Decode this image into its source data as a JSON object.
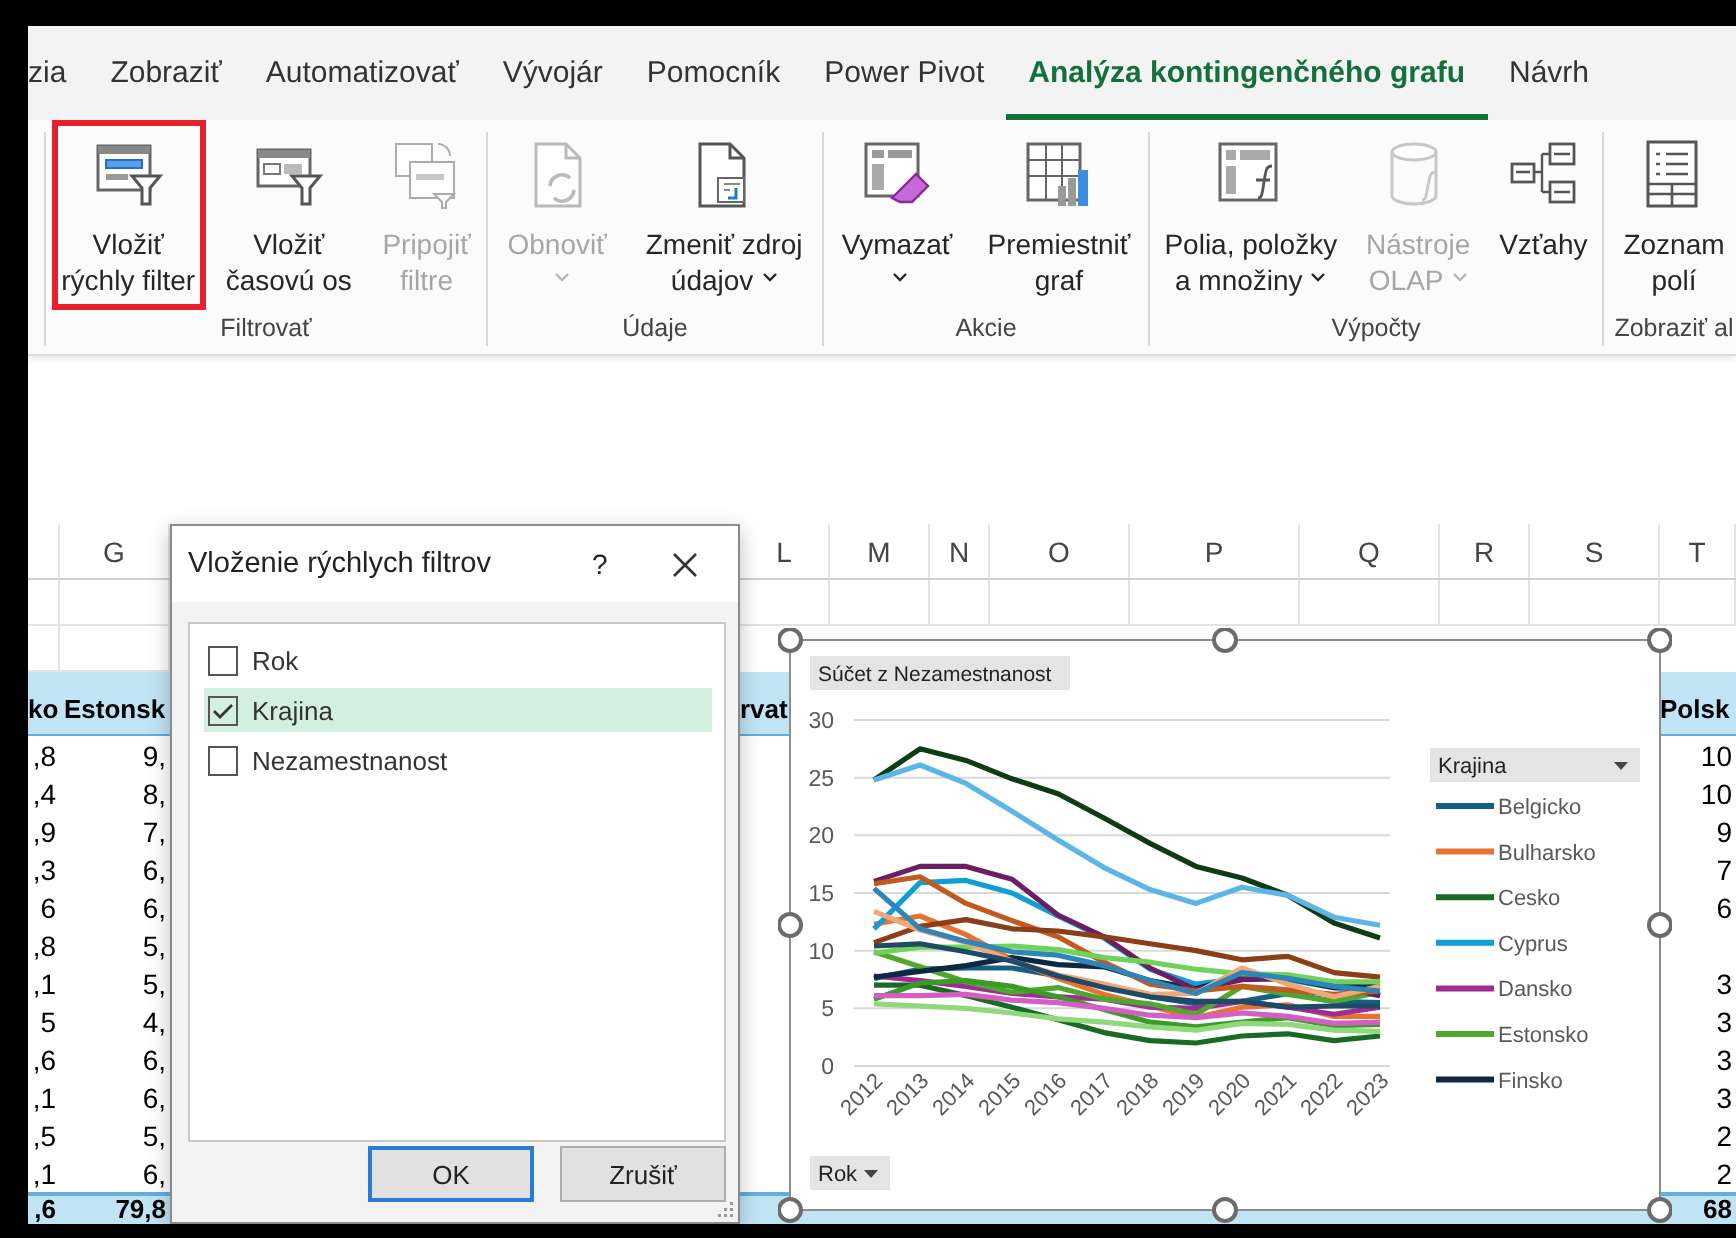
{
  "ribbon": {
    "tabs": [
      {
        "label": "zia",
        "selected": false
      },
      {
        "label": "Zobraziť",
        "selected": false
      },
      {
        "label": "Automatizovať",
        "selected": false
      },
      {
        "label": "Vývojár",
        "selected": false
      },
      {
        "label": "Pomocník",
        "selected": false
      },
      {
        "label": "Power Pivot",
        "selected": false
      },
      {
        "label": "Analýza kontingenčného grafu",
        "selected": true
      },
      {
        "label": "Návrh",
        "selected": false
      }
    ],
    "groups": [
      {
        "label": "Filtrovať",
        "buttons": [
          {
            "lines": [
              "Vložiť",
              "rýchly filter"
            ],
            "dropdown": false,
            "disabled": false,
            "highlighted": true
          },
          {
            "lines": [
              "Vložiť",
              "časovú os"
            ],
            "dropdown": false,
            "disabled": false,
            "highlighted": false
          },
          {
            "lines": [
              "Pripojiť",
              "filtre"
            ],
            "dropdown": false,
            "disabled": true,
            "highlighted": false
          }
        ]
      },
      {
        "label": "Údaje",
        "buttons": [
          {
            "lines": [
              "Obnoviť"
            ],
            "dropdown": true,
            "disabled": true,
            "highlighted": false
          },
          {
            "lines": [
              "Zmeniť zdroj",
              "údajov"
            ],
            "dropdown": true,
            "disabled": false,
            "highlighted": false
          }
        ]
      },
      {
        "label": "Akcie",
        "buttons": [
          {
            "lines": [
              "Vymazať"
            ],
            "dropdown": true,
            "disabled": false,
            "highlighted": false
          },
          {
            "lines": [
              "Premiestniť",
              "graf"
            ],
            "dropdown": false,
            "disabled": false,
            "highlighted": false
          }
        ]
      },
      {
        "label": "Výpočty",
        "buttons": [
          {
            "lines": [
              "Polia, položky",
              "a množiny"
            ],
            "dropdown": true,
            "disabled": false,
            "highlighted": false
          },
          {
            "lines": [
              "Nástroje",
              "OLAP"
            ],
            "dropdown": true,
            "disabled": true,
            "highlighted": false
          },
          {
            "lines": [
              "Vzťahy"
            ],
            "dropdown": false,
            "disabled": false,
            "highlighted": false
          }
        ]
      },
      {
        "label": "Zobraziť al",
        "buttons": [
          {
            "lines": [
              "Zoznam",
              "polí"
            ],
            "dropdown": false,
            "disabled": false,
            "highlighted": false
          }
        ]
      }
    ]
  },
  "sheet": {
    "column_headers": [
      "G",
      "L",
      "M",
      "N",
      "O",
      "P",
      "Q",
      "R",
      "S",
      "T"
    ],
    "table": {
      "header": {
        "column_1": "ko",
        "column_2": "Estonsk",
        "column_3": "rvat",
        "column_4": "Polsk"
      },
      "rows": [
        {
          "column_1": ",8",
          "column_2": "9,",
          "column_4": "10"
        },
        {
          "column_1": ",4",
          "column_2": "8,",
          "column_4": "10"
        },
        {
          "column_1": ",9",
          "column_2": "7,",
          "column_4": "9"
        },
        {
          "column_1": ",3",
          "column_2": "6,",
          "column_4": "7"
        },
        {
          "column_1": "6",
          "column_2": "6,",
          "column_4": "6"
        },
        {
          "column_1": ",8",
          "column_2": "5,"
        },
        {
          "column_1": ",1",
          "column_2": "5,",
          "column_4": "3"
        },
        {
          "column_1": "5",
          "column_2": "4,",
          "column_4": "3"
        },
        {
          "column_1": ",6",
          "column_2": "6,",
          "column_4": "3"
        },
        {
          "column_1": ",1",
          "column_2": "6,",
          "column_4": "3"
        },
        {
          "column_1": ",5",
          "column_2": "5,",
          "column_4": "2"
        },
        {
          "column_1": ",1",
          "column_2": "6,",
          "column_4": "2"
        }
      ],
      "total": {
        "column_1": ",6",
        "column_2": "79,8",
        "column_4": "68"
      }
    }
  },
  "dialog": {
    "title": "Vloženie rýchlych filtrov",
    "help": "?",
    "items": [
      {
        "label": "Rok",
        "checked": false,
        "selected": false
      },
      {
        "label": "Krajina",
        "checked": true,
        "selected": true
      },
      {
        "label": "Nezamestnanost",
        "checked": false,
        "selected": false
      }
    ],
    "buttons": [
      {
        "label": "OK",
        "default": true
      },
      {
        "label": "Zrušiť",
        "default": false
      }
    ]
  },
  "chart": {
    "value_button": "Súčet z Nezamestnanost",
    "legend_field": "Krajina",
    "axis_field": "Rok",
    "chart_data": {
      "type": "line",
      "grid": true,
      "legend": "right",
      "categories": [
        "2012",
        "2013",
        "2014",
        "2015",
        "2016",
        "2017",
        "2018",
        "2019",
        "2020",
        "2021",
        "2022",
        "2023"
      ],
      "yticks": [
        0,
        5,
        10,
        15,
        20,
        25,
        30
      ],
      "ylim": [
        0,
        30
      ],
      "series": [
        {
          "name": "Belgicko",
          "color": "#156082",
          "values": [
            7.6,
            8.4,
            8.5,
            8.5,
            7.8,
            7.1,
            6.0,
            5.4,
            5.6,
            6.3,
            5.6,
            5.5
          ]
        },
        {
          "name": "Bulharsko",
          "color": "#e97132",
          "values": [
            12.3,
            13.0,
            11.4,
            9.2,
            7.6,
            6.2,
            5.2,
            4.2,
            5.1,
            5.3,
            4.3,
            4.3
          ]
        },
        {
          "name": "Cesko",
          "color": "#196b24",
          "values": [
            7.0,
            7.0,
            6.1,
            5.1,
            4.0,
            2.9,
            2.2,
            2.0,
            2.6,
            2.8,
            2.2,
            2.6
          ]
        },
        {
          "name": "Cyprus",
          "color": "#0f9ed5",
          "values": [
            11.9,
            15.9,
            16.1,
            15.0,
            13.0,
            11.1,
            8.4,
            7.1,
            7.6,
            7.5,
            6.8,
            6.1
          ]
        },
        {
          "name": "Dansko",
          "color": "#a02b93",
          "values": [
            7.8,
            7.4,
            6.9,
            6.3,
            6.0,
            5.8,
            5.1,
            5.0,
            5.6,
            5.1,
            4.5,
            5.1
          ]
        },
        {
          "name": "Estonsko",
          "color": "#4ea72e",
          "values": [
            9.9,
            8.6,
            7.3,
            6.4,
            6.8,
            5.8,
            5.4,
            4.5,
            6.9,
            6.2,
            5.6,
            6.4
          ]
        },
        {
          "name": "Finsko",
          "color": "#0e2841",
          "values": [
            7.7,
            8.2,
            8.7,
            9.4,
            8.8,
            8.6,
            7.4,
            6.7,
            7.8,
            7.6,
            6.8,
            7.2
          ]
        },
        {
          "color": "#0f3d13",
          "values": [
            24.8,
            27.5,
            26.5,
            24.9,
            23.6,
            21.5,
            19.3,
            17.3,
            16.3,
            14.8,
            12.4,
            11.1
          ]
        },
        {
          "color": "#5bb5e6",
          "values": [
            24.8,
            26.1,
            24.5,
            22.1,
            19.6,
            17.2,
            15.3,
            14.1,
            15.5,
            14.8,
            12.9,
            12.2
          ]
        },
        {
          "color": "#6b1f62",
          "values": [
            16.0,
            17.3,
            17.3,
            16.2,
            13.1,
            11.2,
            8.5,
            6.6,
            7.5,
            7.6,
            7.0,
            6.1
          ]
        },
        {
          "color": "#c25a1f",
          "values": [
            15.8,
            16.4,
            14.1,
            12.6,
            11.2,
            9.0,
            7.1,
            6.5,
            6.9,
            6.6,
            6.2,
            6.5
          ]
        },
        {
          "color": "#8b3f17",
          "values": [
            10.7,
            12.1,
            12.7,
            11.9,
            11.7,
            11.2,
            10.6,
            10.0,
            9.2,
            9.5,
            8.1,
            7.7
          ]
        },
        {
          "color": "#6fd35a",
          "values": [
            9.8,
            10.3,
            10.3,
            10.4,
            10.1,
            9.4,
            9.0,
            8.4,
            8.0,
            7.9,
            7.3,
            7.3
          ]
        },
        {
          "color": "#f0a878",
          "values": [
            13.4,
            11.8,
            10.7,
            9.1,
            7.9,
            7.1,
            6.2,
            6.3,
            8.5,
            7.1,
            6.0,
            6.9
          ]
        },
        {
          "color": "#2e86b8",
          "values": [
            15.4,
            11.9,
            10.8,
            9.9,
            9.6,
            8.7,
            7.4,
            6.3,
            8.1,
            7.6,
            6.9,
            6.5
          ]
        },
        {
          "color": "#3c9b28",
          "values": [
            5.8,
            7.2,
            7.4,
            6.9,
            6.0,
            4.9,
            3.8,
            3.4,
            3.8,
            4.2,
            3.5,
            3.6
          ]
        },
        {
          "color": "#8fd97c",
          "values": [
            5.4,
            5.2,
            5.0,
            4.6,
            4.1,
            3.8,
            3.4,
            3.1,
            3.7,
            3.6,
            3.1,
            3.0
          ]
        },
        {
          "color": "#d45fc4",
          "values": [
            6.1,
            6.1,
            6.2,
            5.7,
            5.5,
            5.0,
            4.4,
            4.2,
            4.6,
            4.3,
            3.7,
            3.8
          ]
        },
        {
          "color": "#1e4a66",
          "values": [
            10.4,
            10.6,
            9.9,
            9.1,
            7.8,
            6.8,
            6.0,
            5.6,
            5.6,
            5.1,
            5.2,
            5.2
          ]
        }
      ]
    }
  }
}
